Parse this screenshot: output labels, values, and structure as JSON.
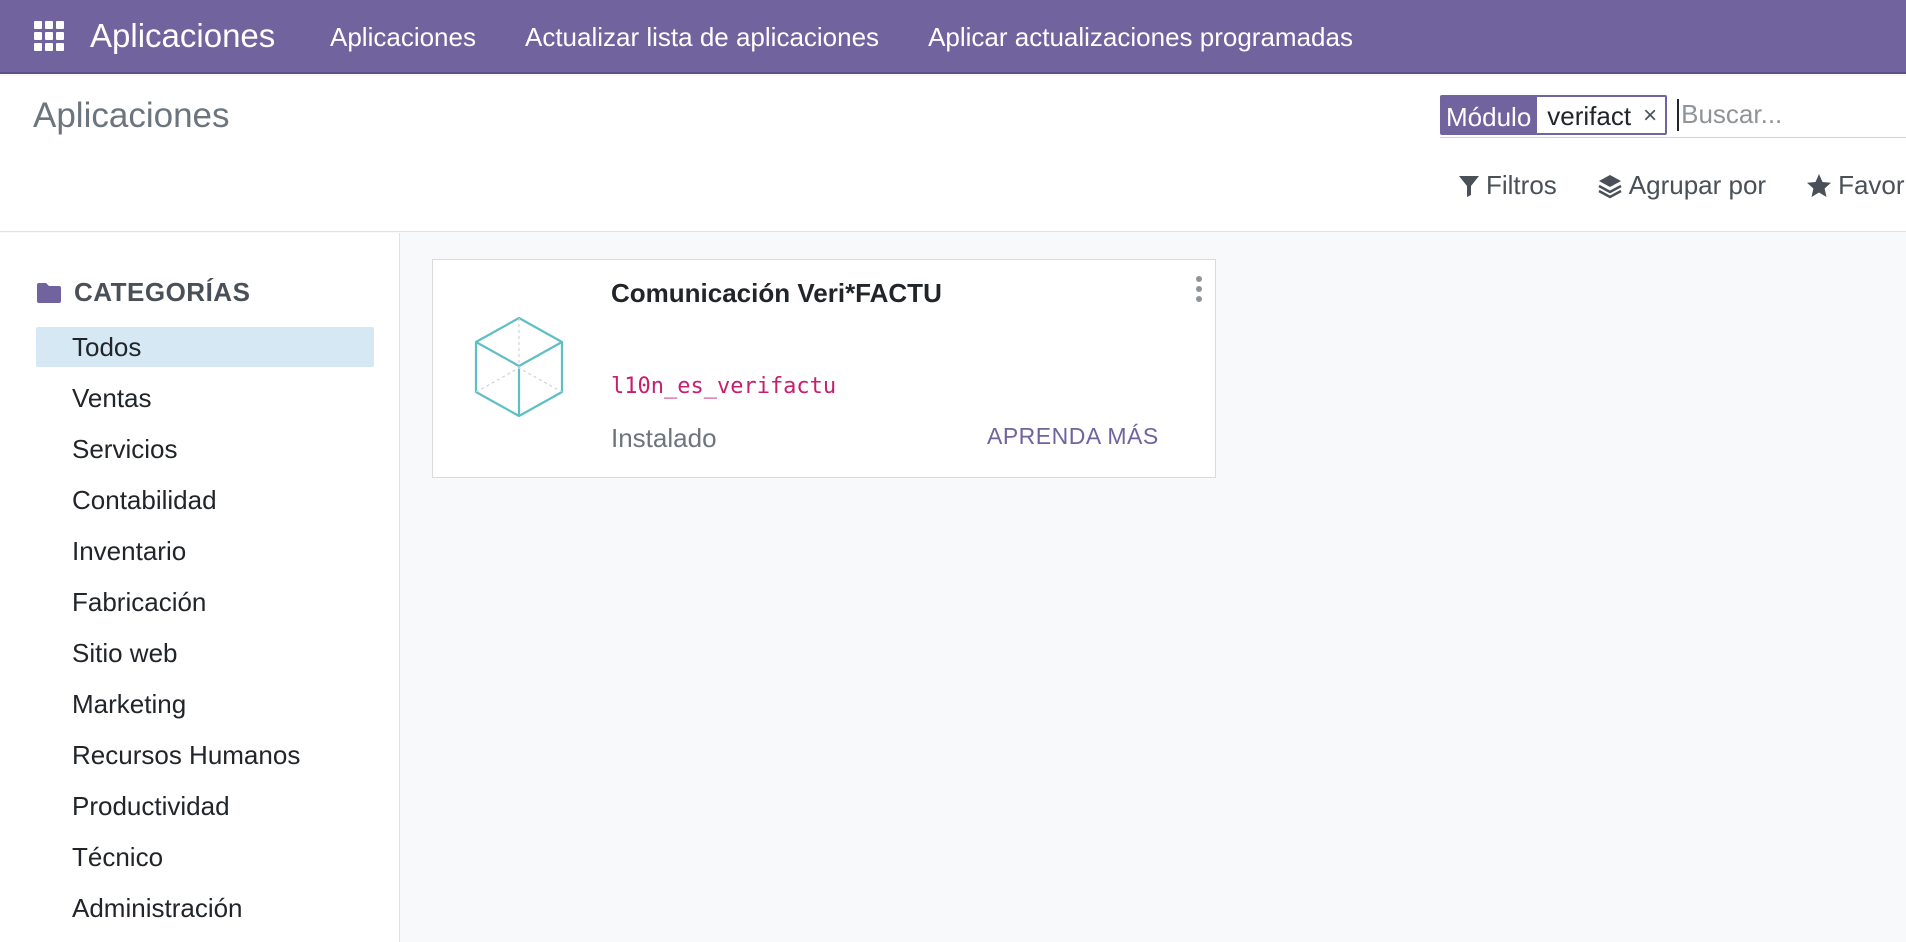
{
  "navbar": {
    "brand": "Aplicaciones",
    "menu": [
      {
        "label": "Aplicaciones"
      },
      {
        "label": "Actualizar lista de aplicaciones"
      },
      {
        "label": "Aplicar actualizaciones programadas"
      }
    ],
    "icons": {
      "apps": "grid-icon"
    },
    "colors": {
      "brand": "#71639e"
    }
  },
  "control_panel": {
    "breadcrumb": "Aplicaciones",
    "search": {
      "facet_label": "Módulo",
      "facet_value": "verifact",
      "facet_remove": "×",
      "placeholder": "Buscar..."
    },
    "options": [
      {
        "label": "Filtros",
        "icon": "filter-icon"
      },
      {
        "label": "Agrupar por",
        "icon": "layers-icon"
      },
      {
        "label": "Favoritos",
        "icon": "star-icon"
      }
    ]
  },
  "sidebar": {
    "header": "CATEGORÍAS",
    "header_icon": "folder-icon",
    "items": [
      {
        "label": "Todos",
        "active": true
      },
      {
        "label": "Ventas"
      },
      {
        "label": "Servicios"
      },
      {
        "label": "Contabilidad"
      },
      {
        "label": "Inventario"
      },
      {
        "label": "Fabricación"
      },
      {
        "label": "Sitio web"
      },
      {
        "label": "Marketing"
      },
      {
        "label": "Recursos Humanos"
      },
      {
        "label": "Productividad"
      },
      {
        "label": "Técnico"
      },
      {
        "label": "Administración"
      }
    ]
  },
  "kanban": {
    "card": {
      "title": "Comunicación Veri*FACTU",
      "technical_name": "l10n_es_verifactu",
      "status": "Instalado",
      "learn_more": "APRENDA MÁS",
      "icon": "cube-icon",
      "colors": {
        "tech_name": "#c81e6d",
        "learn_more": "#71639e",
        "icon": "#5fbfc4"
      }
    }
  }
}
